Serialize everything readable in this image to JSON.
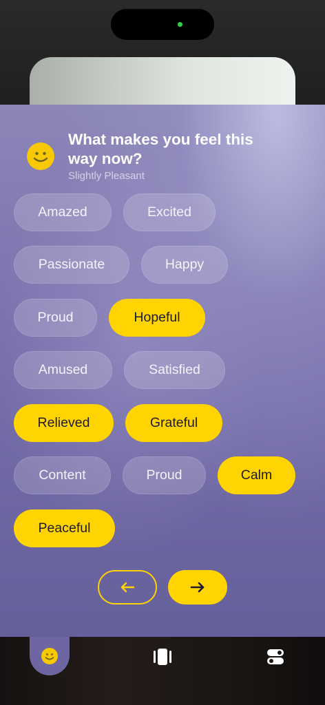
{
  "header": {
    "question": "What makes you feel this way now?",
    "mood": "Slightly Pleasant",
    "mood_icon": "smiley-face-icon"
  },
  "emotions": [
    {
      "label": "Amazed",
      "selected": false
    },
    {
      "label": "Excited",
      "selected": false
    },
    {
      "label": "Passionate",
      "selected": false
    },
    {
      "label": "Happy",
      "selected": false
    },
    {
      "label": "Proud",
      "selected": false
    },
    {
      "label": "Hopeful",
      "selected": true
    },
    {
      "label": "Amused",
      "selected": false
    },
    {
      "label": "Satisfied",
      "selected": false
    },
    {
      "label": "Relieved",
      "selected": true
    },
    {
      "label": "Grateful",
      "selected": true
    },
    {
      "label": "Content",
      "selected": false
    },
    {
      "label": "Proud",
      "selected": false
    },
    {
      "label": "Calm",
      "selected": true
    },
    {
      "label": "Peaceful",
      "selected": true
    }
  ],
  "nav": {
    "back_icon": "arrow-left-icon",
    "next_icon": "arrow-right-icon"
  },
  "tabbar": {
    "tabs": [
      {
        "icon": "smiley-face-icon",
        "active": true
      },
      {
        "icon": "cards-icon",
        "active": false
      },
      {
        "icon": "toggles-icon",
        "active": false
      }
    ]
  },
  "colors": {
    "accent": "#ffd400",
    "sheet": "#7a72ad"
  }
}
